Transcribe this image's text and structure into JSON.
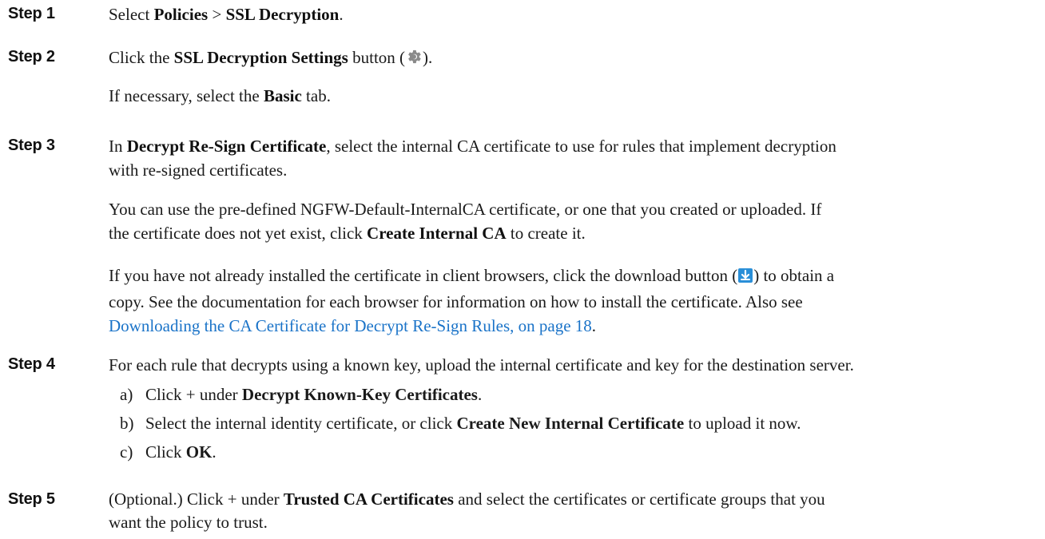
{
  "steps": [
    {
      "label": "Step 1",
      "select": "Select",
      "policies": "Policies",
      "sep": ">",
      "ssl": "SSL Decryption",
      "period": "."
    },
    {
      "label": "Step 2",
      "click": "Click the",
      "button_name": "SSL Decryption Settings",
      "button_word": "button (",
      "close": ").",
      "p2_pre": "If necessary, select the",
      "basic": "Basic",
      "p2_post": "tab."
    },
    {
      "label": "Step 3",
      "in": "In",
      "decrypt_resign": "Decrypt Re-Sign Certificate",
      "p1_rest_line1": ", select the internal CA certificate to use for rules that implement decryption",
      "p1_rest_line2": "with re-signed certificates.",
      "p2_line1": "You can use the pre-defined NGFW-Default-InternalCA certificate, or one that you created or uploaded. If",
      "p2_line2_pre": "the certificate does not yet exist, click",
      "create_ca": "Create Internal CA",
      "p2_line2_post": "to create it.",
      "p3_line1_pre": "If you have not already installed the certificate in client browsers, click the download button (",
      "p3_line1_post": ") to obtain a",
      "p3_line2": "copy. See the documentation for each browser for information on how to install the certificate. Also see",
      "link_text": "Downloading the CA Certificate for Decrypt Re-Sign Rules, on page 18",
      "link_period": "."
    },
    {
      "label": "Step 4",
      "text": "For each rule that decrypts using a known key, upload the internal certificate and key for the destination server.",
      "sub_a_marker": "a)",
      "sub_a_pre": "Click + under",
      "sub_a_bold": "Decrypt Known-Key Certificates",
      "sub_a_post": ".",
      "sub_b_marker": "b)",
      "sub_b_pre": "Select the internal identity certificate, or click",
      "sub_b_bold": "Create New Internal Certificate",
      "sub_b_post": "to upload it now.",
      "sub_c_marker": "c)",
      "sub_c_pre": "Click",
      "sub_c_bold": "OK",
      "sub_c_post": "."
    },
    {
      "label": "Step 5",
      "pre": "(Optional.) Click + under",
      "trusted": "Trusted CA Certificates",
      "post_line1": "and select the certificates or certificate groups that you",
      "line2": "want the policy to trust."
    }
  ],
  "icons": {
    "settings": "gear-icon",
    "download": "download-icon",
    "gear_color": "#8a8a8a",
    "download_color": "#2a8fd8"
  }
}
